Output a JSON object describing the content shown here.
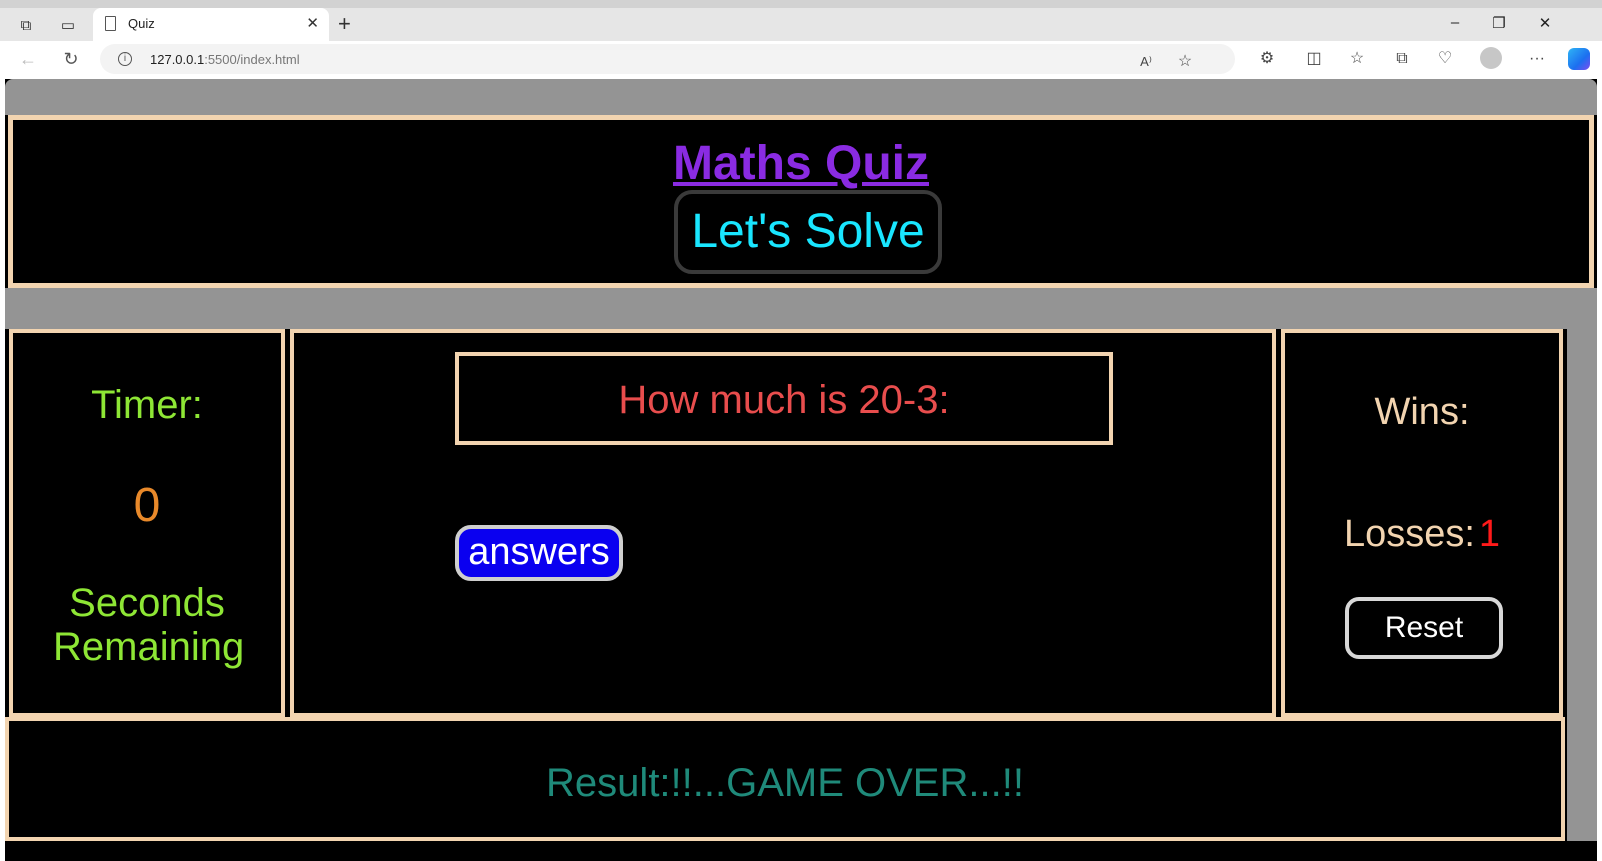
{
  "browser": {
    "tab_title": "Quiz",
    "url_host": "127.0.0.1",
    "url_rest": ":5500/index.html"
  },
  "header": {
    "title": "Maths Quiz",
    "solve_button": "Let's Solve"
  },
  "timer": {
    "label": "Timer:",
    "value": "0",
    "seconds_label": "Seconds Remaining"
  },
  "quiz": {
    "question": "How much is 20-3:",
    "answers_button": "answers"
  },
  "score": {
    "wins_label": "Wins:",
    "losses_label": "Losses:",
    "losses_value": "1",
    "reset_button": "Reset"
  },
  "result": {
    "text": "Result:!!...GAME OVER...!!"
  },
  "colors": {
    "title": "#8a2be2",
    "solve_text": "#19e6ff",
    "timer_text": "#8ee635",
    "timer_value": "#e8892a",
    "question_text": "#e84d4d",
    "answers_bg": "#0a00f0",
    "score_text": "#f2d4b0",
    "losses_value": "#ff1a1a",
    "result_text": "#1f8a7a",
    "panel_border": "#f2d4b0"
  }
}
